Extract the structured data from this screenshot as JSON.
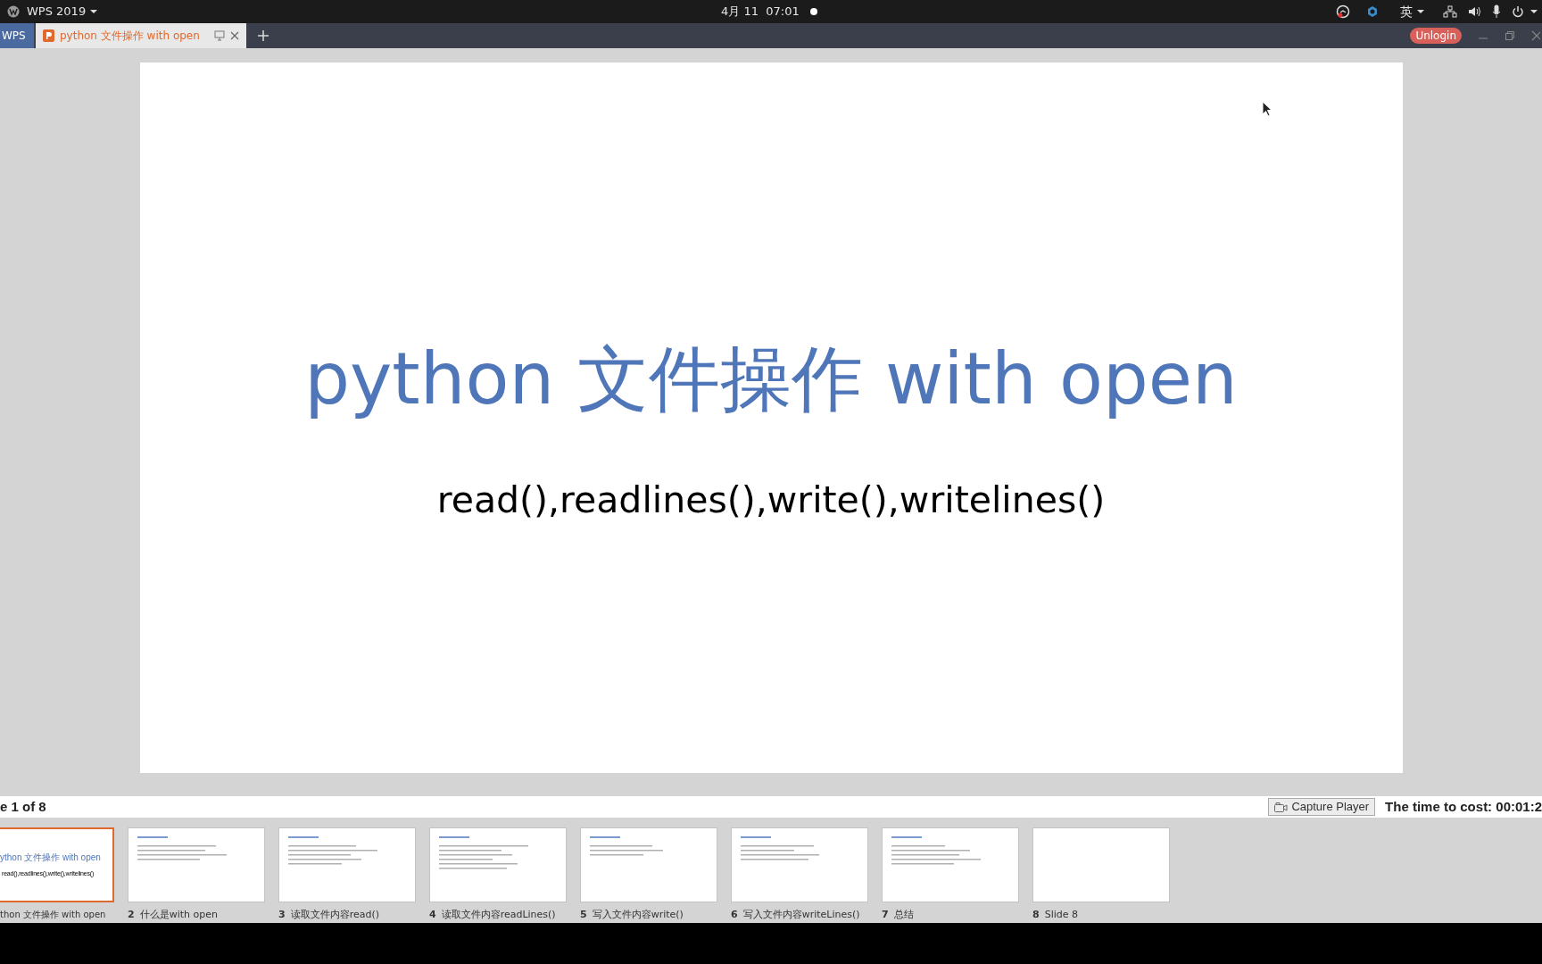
{
  "top_bar": {
    "app_menu": "WPS 2019",
    "clock": "4月 11  07:01",
    "input_method": "英"
  },
  "tabs": [
    {
      "label": "WPS",
      "kind": "home",
      "selected": false
    },
    {
      "label": "python 文件操作 with open",
      "kind": "document",
      "selected": true
    }
  ],
  "account_button": "Unlogin",
  "slide": {
    "title": "python 文件操作 with open",
    "subtitle": "read(),readlines(),write(),writelines()"
  },
  "status": {
    "slide_counter": "e 1 of 8",
    "capture_button": "Capture Player",
    "time_cost": "The time to cost: 00:01:2"
  },
  "thumbnails": [
    {
      "kind": "title",
      "label": "thon 文件操作 with open",
      "selected": true,
      "preview_title": "ython 文件操作 with open",
      "preview_subtitle": "read(),readlines(),write(),writelines()"
    },
    {
      "kind": "content",
      "number": "2",
      "label": "什么是with open",
      "selected": false
    },
    {
      "kind": "content",
      "number": "3",
      "label": "读取文件内容read()",
      "selected": false
    },
    {
      "kind": "content",
      "number": "4",
      "label": "读取文件内容readLines()",
      "selected": false
    },
    {
      "kind": "content",
      "number": "5",
      "label": "写入文件内容write()",
      "selected": false
    },
    {
      "kind": "content",
      "number": "6",
      "label": "写入文件内容writeLines()",
      "selected": false
    },
    {
      "kind": "content",
      "number": "7",
      "label": "总结",
      "selected": false
    },
    {
      "kind": "blank",
      "number": "8",
      "label": "Slide 8",
      "selected": false
    }
  ]
}
